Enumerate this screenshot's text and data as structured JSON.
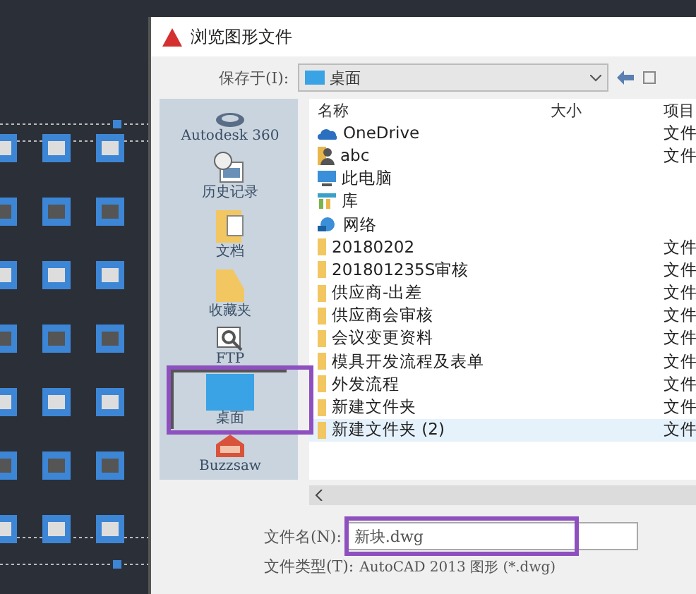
{
  "dialog": {
    "title": "浏览图形文件",
    "save_in_label": "保存于(I):",
    "save_in_value": "桌面"
  },
  "places": [
    {
      "kind": "cloud",
      "label": "Autodesk 360",
      "selected": false
    },
    {
      "kind": "history",
      "label": "历史记录",
      "selected": false
    },
    {
      "kind": "documents",
      "label": "文档",
      "selected": false
    },
    {
      "kind": "favorites",
      "label": "收藏夹",
      "selected": false
    },
    {
      "kind": "ftp",
      "label": "FTP",
      "selected": false
    },
    {
      "kind": "desktop",
      "label": "桌面",
      "selected": true
    },
    {
      "kind": "buzzsaw",
      "label": "Buzzsaw",
      "selected": false
    }
  ],
  "columns": [
    "名称",
    "大小",
    "项目"
  ],
  "files": [
    {
      "kind": "cloud",
      "name": "OneDrive",
      "type": "文件",
      "selected": false
    },
    {
      "kind": "user",
      "name": "abc",
      "type": "文件",
      "selected": false
    },
    {
      "kind": "computer",
      "name": "此电脑",
      "selected": false
    },
    {
      "kind": "library",
      "name": "库",
      "selected": false
    },
    {
      "kind": "network",
      "name": "网络",
      "selected": false
    },
    {
      "kind": "folder",
      "name": "20180202",
      "type": "文件",
      "selected": false
    },
    {
      "kind": "folder",
      "name": "201801235S审核",
      "type": "文件",
      "selected": false
    },
    {
      "kind": "folder",
      "name": "供应商-出差",
      "type": "文件",
      "selected": false
    },
    {
      "kind": "folder",
      "name": "供应商会审核",
      "type": "文件",
      "selected": false
    },
    {
      "kind": "folder",
      "name": "会议变更资料",
      "type": "文件",
      "selected": false
    },
    {
      "kind": "folder",
      "name": "模具开发流程及表单",
      "type": "文件",
      "selected": false
    },
    {
      "kind": "folder",
      "name": "外发流程",
      "type": "文件",
      "selected": false
    },
    {
      "kind": "folder",
      "name": "新建文件夹",
      "type": "文件",
      "selected": false
    },
    {
      "kind": "folder",
      "name": "新建文件夹 (2)",
      "type": "文件",
      "selected": true
    }
  ],
  "filename": {
    "label": "文件名(N):",
    "value": "新块.dwg"
  },
  "filetype": {
    "label": "文件类型(T):",
    "value": "AutoCAD 2013 图形 (*.dwg)"
  }
}
